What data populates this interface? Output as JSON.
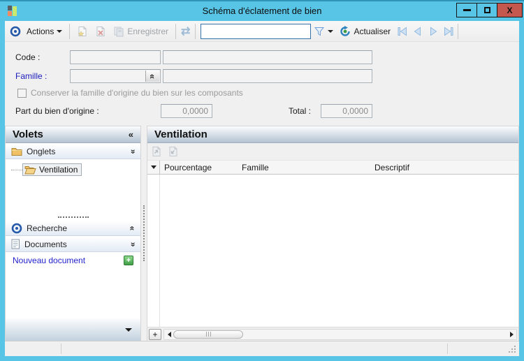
{
  "window": {
    "title": "Schéma d'éclatement de bien",
    "close_glyph": "X"
  },
  "toolbar": {
    "actions_label": "Actions",
    "save_label": "Enregistrer",
    "search_value": "",
    "refresh_label": "Actualiser"
  },
  "form": {
    "code_label": "Code :",
    "code_value": "",
    "code_desc_value": "",
    "famille_label": "Famille :",
    "famille_value": "",
    "famille_desc_value": "",
    "checkbox_label": "Conserver la famille d'origine du bien sur les composants",
    "part_label": "Part du bien d'origine :",
    "part_value": "0,0000",
    "total_label": "Total :",
    "total_value": "0,0000"
  },
  "sidebar": {
    "title": "Volets",
    "onglets_label": "Onglets",
    "tree_items": [
      {
        "label": "Ventilation",
        "selected": true
      }
    ],
    "recherche_label": "Recherche",
    "documents_label": "Documents",
    "new_document_label": "Nouveau document"
  },
  "main": {
    "title": "Ventilation",
    "columns": [
      "Pourcentage",
      "Famille",
      "Descriptif"
    ],
    "rows": []
  },
  "icons": {
    "double_chevron": "«",
    "sync": "⇄",
    "plus": "+"
  },
  "colors": {
    "titlebar_blue": "#58c5e7",
    "close_red": "#c4574e",
    "panel_bg": "#f0f0f0",
    "accent_blue": "#2458a8",
    "link_blue": "#2222cc",
    "famille_label_blue": "#1b1bbd",
    "green_plus": "#3f9e46",
    "pale_nav_blue": "#cfe2f5"
  }
}
